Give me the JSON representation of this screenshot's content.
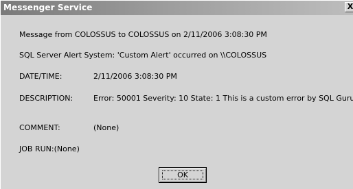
{
  "window": {
    "title": "Messenger Service",
    "close_glyph": "X"
  },
  "message": {
    "header_line": "Message from COLOSSUS to COLOSSUS on 2/11/2006 3:08:30 PM",
    "alert_line": "SQL Server Alert System: 'Custom Alert' occurred on \\\\COLOSSUS",
    "fields": {
      "datetime_label": "DATE/TIME:",
      "datetime_value": "2/11/2006 3:08:30 PM",
      "description_label": "DESCRIPTION:",
      "description_value": "Error: 50001 Severity: 10 State: 1 This is a custom error by SQL Guru",
      "comment_label": "COMMENT:",
      "comment_value": "(None)",
      "jobrun_text": "JOB RUN:(None)"
    }
  },
  "buttons": {
    "ok_label": "OK"
  }
}
